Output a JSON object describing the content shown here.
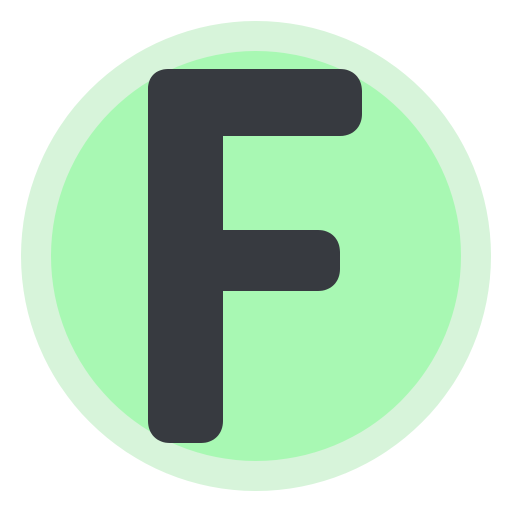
{
  "icon": {
    "name": "letter-f-app-icon",
    "letter": "F",
    "colors": {
      "background": "#ffffff",
      "outer_ring": "#d7f4da",
      "inner_circle": "#a8f8b3",
      "letter": "#373a40"
    }
  }
}
